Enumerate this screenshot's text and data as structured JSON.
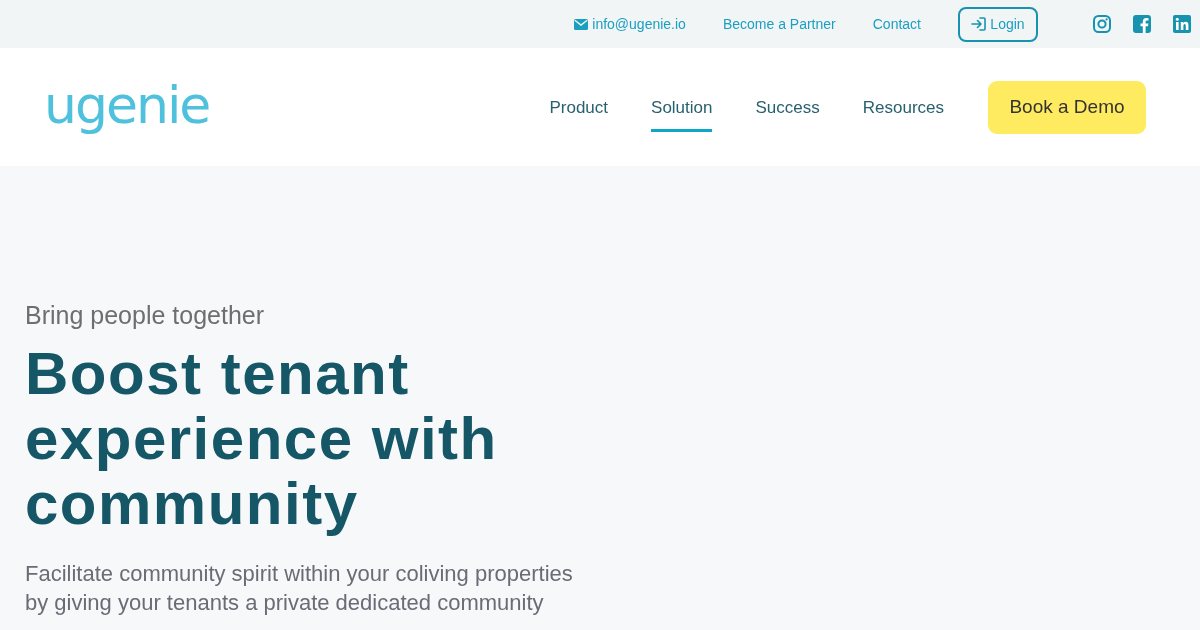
{
  "top_bar": {
    "email": "info@ugenie.io",
    "links": [
      "Become a Partner",
      "Contact"
    ],
    "login_button": "Login"
  },
  "header": {
    "logo": "ugenie",
    "nav": [
      {
        "label": "Product",
        "selected": false
      },
      {
        "label": "Solution",
        "selected": true
      },
      {
        "label": "Success",
        "selected": false
      },
      {
        "label": "Resources",
        "selected": false
      }
    ],
    "cta_button": "Book a Demo"
  },
  "hero": {
    "eyebrow": "Bring people together",
    "heading": "Boost tenant experience with community",
    "description": "Facilitate community spirit within your coliving properties by giving your tenants a private dedicated community"
  }
}
